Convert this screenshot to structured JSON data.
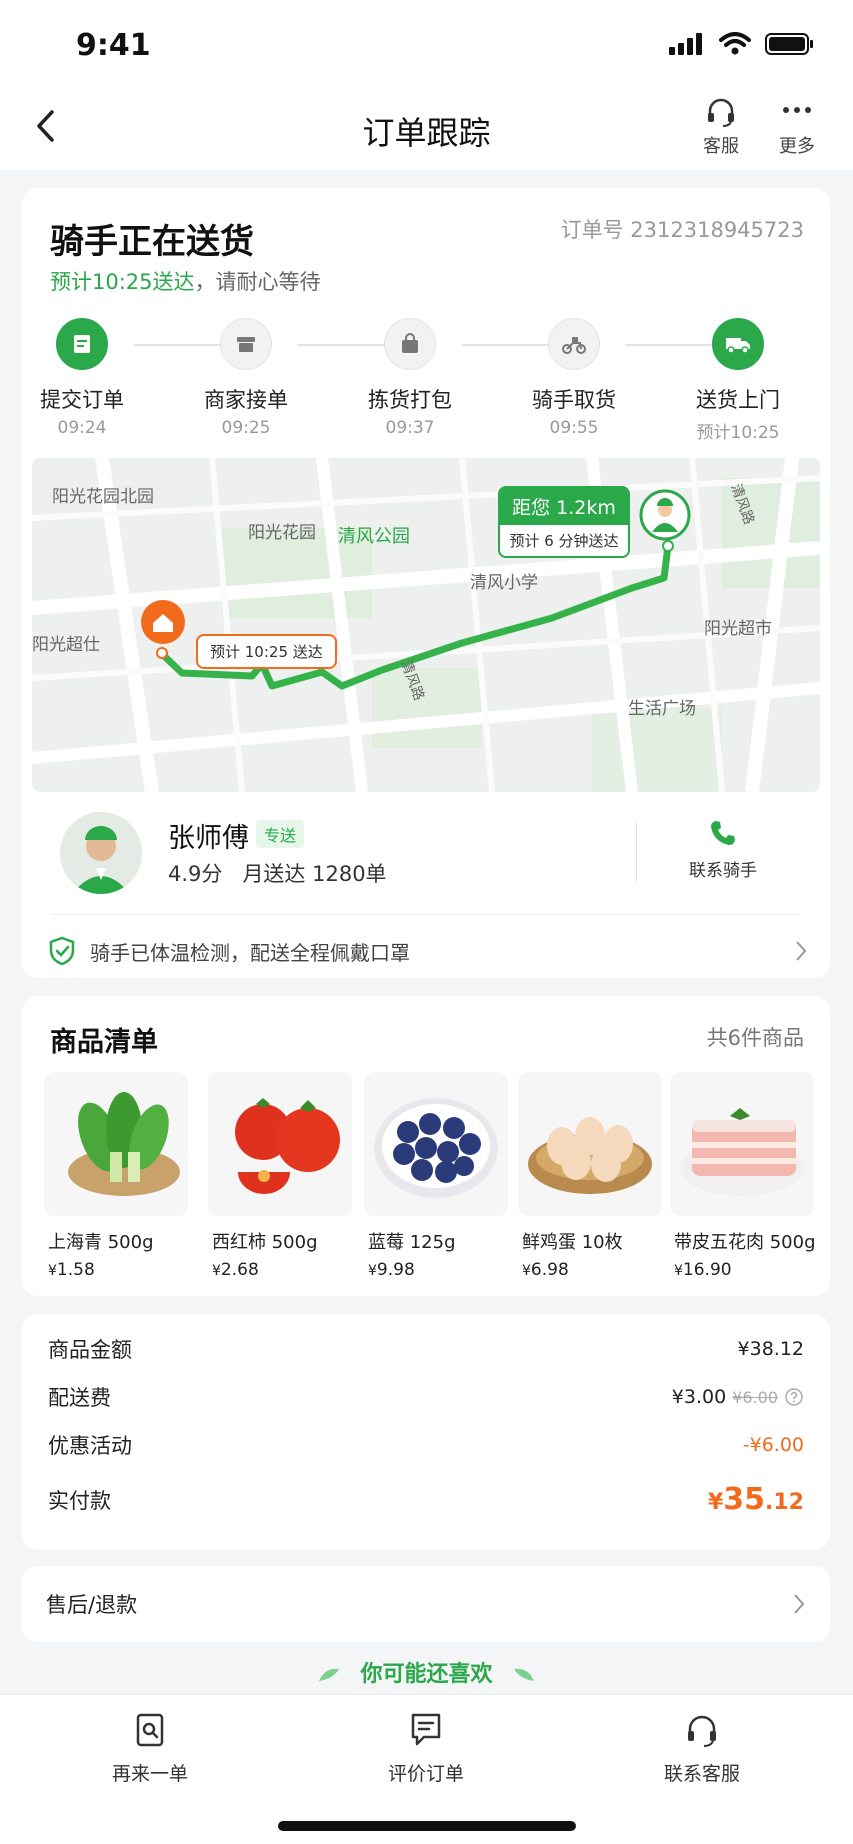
{
  "status_bar": {
    "time": "9:41"
  },
  "nav": {
    "title": "订单跟踪",
    "service_label": "客服",
    "more_label": "更多"
  },
  "order": {
    "status_title": "骑手正在送货",
    "eta_highlight": "预计10:25送达",
    "eta_suffix": "，请耐心等待",
    "order_no_label": "订单号",
    "order_no": "2312318945723"
  },
  "steps": [
    {
      "label": "提交订单",
      "time": "09:24",
      "icon": "receipt-icon",
      "active": true
    },
    {
      "label": "商家接单",
      "time": "09:25",
      "icon": "store-icon",
      "active": false
    },
    {
      "label": "拣货打包",
      "time": "09:37",
      "icon": "bag-icon",
      "active": false
    },
    {
      "label": "骑手取货",
      "time": "09:55",
      "icon": "scooter-icon",
      "active": false
    },
    {
      "label": "送货上门",
      "time": "预计10:25",
      "icon": "truck-icon",
      "active": true
    }
  ],
  "map": {
    "labels": [
      "阳光花园北园",
      "阳光花园",
      "清风公园",
      "清风小学",
      "阳光超市",
      "生活广场",
      "阳光超仕",
      "清风路",
      "清风路"
    ],
    "rider_distance": "距您 1.2km",
    "rider_eta": "预计 6 分钟送达",
    "home_eta": "预计 10:25 送达"
  },
  "rider": {
    "name": "张师傅",
    "badge": "专送",
    "rating": "4.9分",
    "monthly": "月送达 1280单",
    "contact_label": "联系骑手"
  },
  "safety_note": "骑手已体温检测，配送全程佩戴口罩",
  "goods": {
    "title": "商品清单",
    "count_label": "共6件商品",
    "items": [
      {
        "name": "上海青 500g",
        "currency": "¥",
        "price": "1.58"
      },
      {
        "name": "西红柿 500g",
        "currency": "¥",
        "price": "2.68"
      },
      {
        "name": "蓝莓 125g",
        "currency": "¥",
        "price": "9.98"
      },
      {
        "name": "鲜鸡蛋 10枚",
        "currency": "¥",
        "price": "6.98"
      },
      {
        "name": "带皮五花肉 500g",
        "currency": "¥",
        "price": "16.90"
      }
    ]
  },
  "prices": {
    "goods_amount_label": "商品金额",
    "goods_amount": "¥38.12",
    "delivery_label": "配送费",
    "delivery": "¥3.00",
    "delivery_original": "¥6.00",
    "discount_label": "优惠活动",
    "discount": "-¥6.00",
    "paid_label": "实付款",
    "paid_currency": "¥",
    "paid_int": "35",
    "paid_dec": ".12"
  },
  "after_sale_label": "售后/退款",
  "recommend_label": "你可能还喜欢",
  "bottom_bar": {
    "reorder": "再来一单",
    "review": "评价订单",
    "support": "联系客服"
  },
  "colors": {
    "brand_green": "#2aa84a",
    "accent_orange": "#f26b1d"
  }
}
